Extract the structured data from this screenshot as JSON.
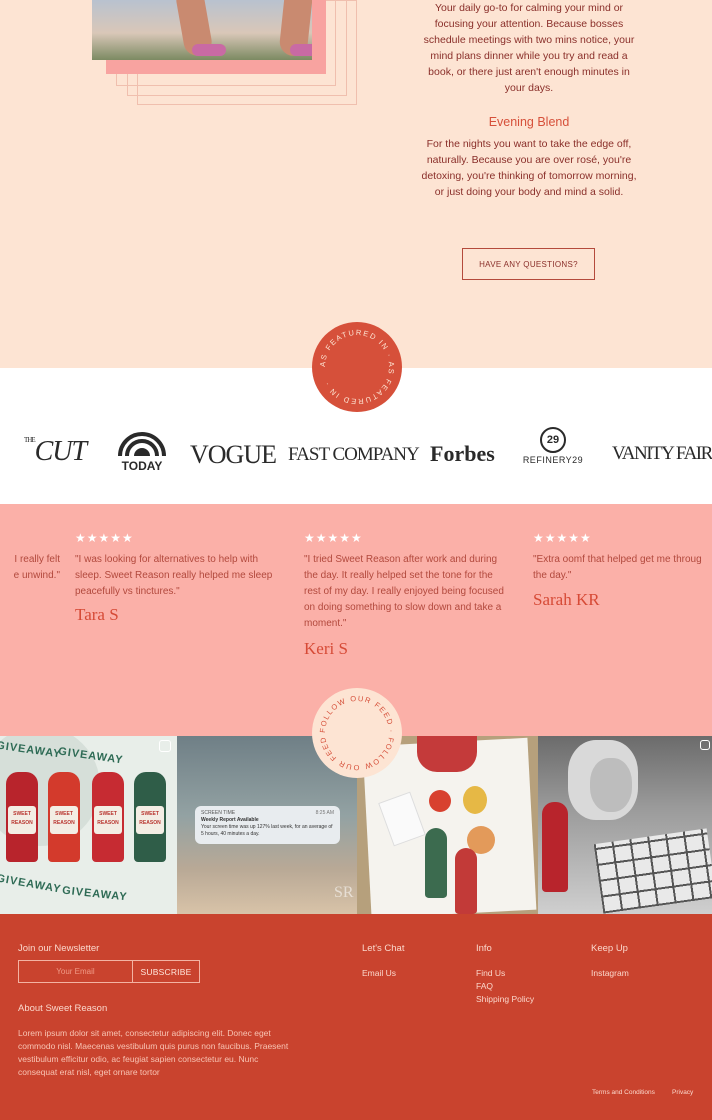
{
  "intro": {
    "daily_text": "Your daily go-to for calming your mind or focusing your attention. Because bosses schedule meetings with two mins notice, your mind plans dinner while you try and read a book, or there just aren't enough minutes in your days.",
    "evening_title": "Evening Blend",
    "evening_text": "For the nights you want to take the edge off, naturally. Because you are over rosé, you're detoxing, you're thinking of tomorrow morning, or just doing your body and mind a solid.",
    "questions_button": "HAVE ANY QUESTIONS?"
  },
  "featured": {
    "badge_text": "AS FEATURED IN · AS FEATURED IN ·",
    "logos": [
      "THE CUT",
      "TODAY",
      "VOGUE",
      "FAST COMPANY",
      "Forbes",
      "REFINERY29",
      "VANITY FAIR"
    ]
  },
  "reviews": {
    "stars": "★★★★★",
    "items": [
      {
        "text_lines": [
          "I really felt",
          "e unwind.\""
        ],
        "name": ""
      },
      {
        "text_lines": [
          "\"I was looking for alternatives to help with",
          "sleep. Sweet Reason really helped me sleep",
          "peacefully vs tinctures.\""
        ],
        "name": "Tara S"
      },
      {
        "text_lines": [
          "\"I tried Sweet Reason after work and during",
          "the day. It really helped set the tone for the",
          "rest of my day. I really enjoyed being focused",
          "on doing something to slow down and take a",
          "moment.\""
        ],
        "name": "Keri S"
      },
      {
        "text_lines": [
          "\"Extra oomf that helped get me throug",
          "the day.\""
        ],
        "name": "Sarah KR"
      }
    ]
  },
  "feed": {
    "badge_text": "FOLLOW OUR FEED · FOLLOW OUR FEED ·",
    "giveaway_word": "GIVEAWAY",
    "bottle_label": "SWEET REASON",
    "notification": {
      "app": "SCREEN TIME",
      "time": "8:25 AM",
      "title": "Weekly Report Available",
      "body": "Your screen time was up 127% last week, for an average of 5 hours, 40 minutes a day."
    },
    "watermark": "SR"
  },
  "footer": {
    "newsletter_heading": "Join our Newsletter",
    "email_placeholder": "Your Email",
    "subscribe_label": "SUBSCRIBE",
    "about_heading": "About Sweet Reason",
    "about_text": "Lorem ipsum dolor sit amet, consectetur adipiscing elit. Donec eget commodo nisl. Maecenas vestibulum quis purus non faucibus. Praesent vestibulum efficitur odio, ac feugiat sapien consectetur eu. Nunc consequat erat nisl, eget ornare tortor",
    "chat_heading": "Let's Chat",
    "chat_links": [
      "Email Us"
    ],
    "info_heading": "Info",
    "info_links": [
      "Find Us",
      "FAQ",
      "Shipping Policy"
    ],
    "keep_heading": "Keep Up",
    "keep_links": [
      "Instagram"
    ],
    "legal_links": [
      "Terms and Conditions",
      "Privacy"
    ]
  },
  "colors": {
    "peach_bg": "#fde4d3",
    "accent_red": "#d6503a",
    "review_bg": "#fbb0a8",
    "footer_bg": "#c9432e"
  }
}
